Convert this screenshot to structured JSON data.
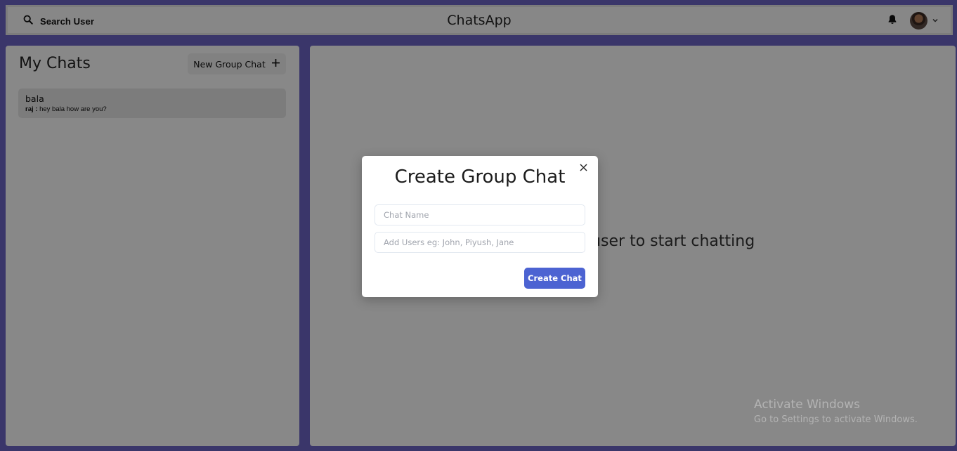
{
  "header": {
    "search_label": "Search User",
    "app_title": "ChatsApp"
  },
  "left_panel": {
    "title": "My Chats",
    "new_group_button": "New Group Chat",
    "chats": [
      {
        "name": "bala",
        "latest_sender": "raj :",
        "latest_message": "hey bala how are you?"
      }
    ]
  },
  "right_panel": {
    "placeholder": "Click on a user to start chatting"
  },
  "modal": {
    "title": "Create Group Chat",
    "chat_name_placeholder": "Chat Name",
    "add_users_placeholder": "Add Users eg: John, Piyush, Jane",
    "create_button": "Create Chat"
  },
  "watermark": {
    "title": "Activate Windows",
    "subtitle": "Go to Settings to activate Windows."
  },
  "icons": [
    "search-icon",
    "bell-icon",
    "avatar",
    "chevron-down-icon",
    "plus-icon",
    "close-icon"
  ],
  "colors": {
    "background": "#6c64c4",
    "primary_button": "#4c63d2",
    "overlay": "rgba(0,0,0,0.46)"
  }
}
